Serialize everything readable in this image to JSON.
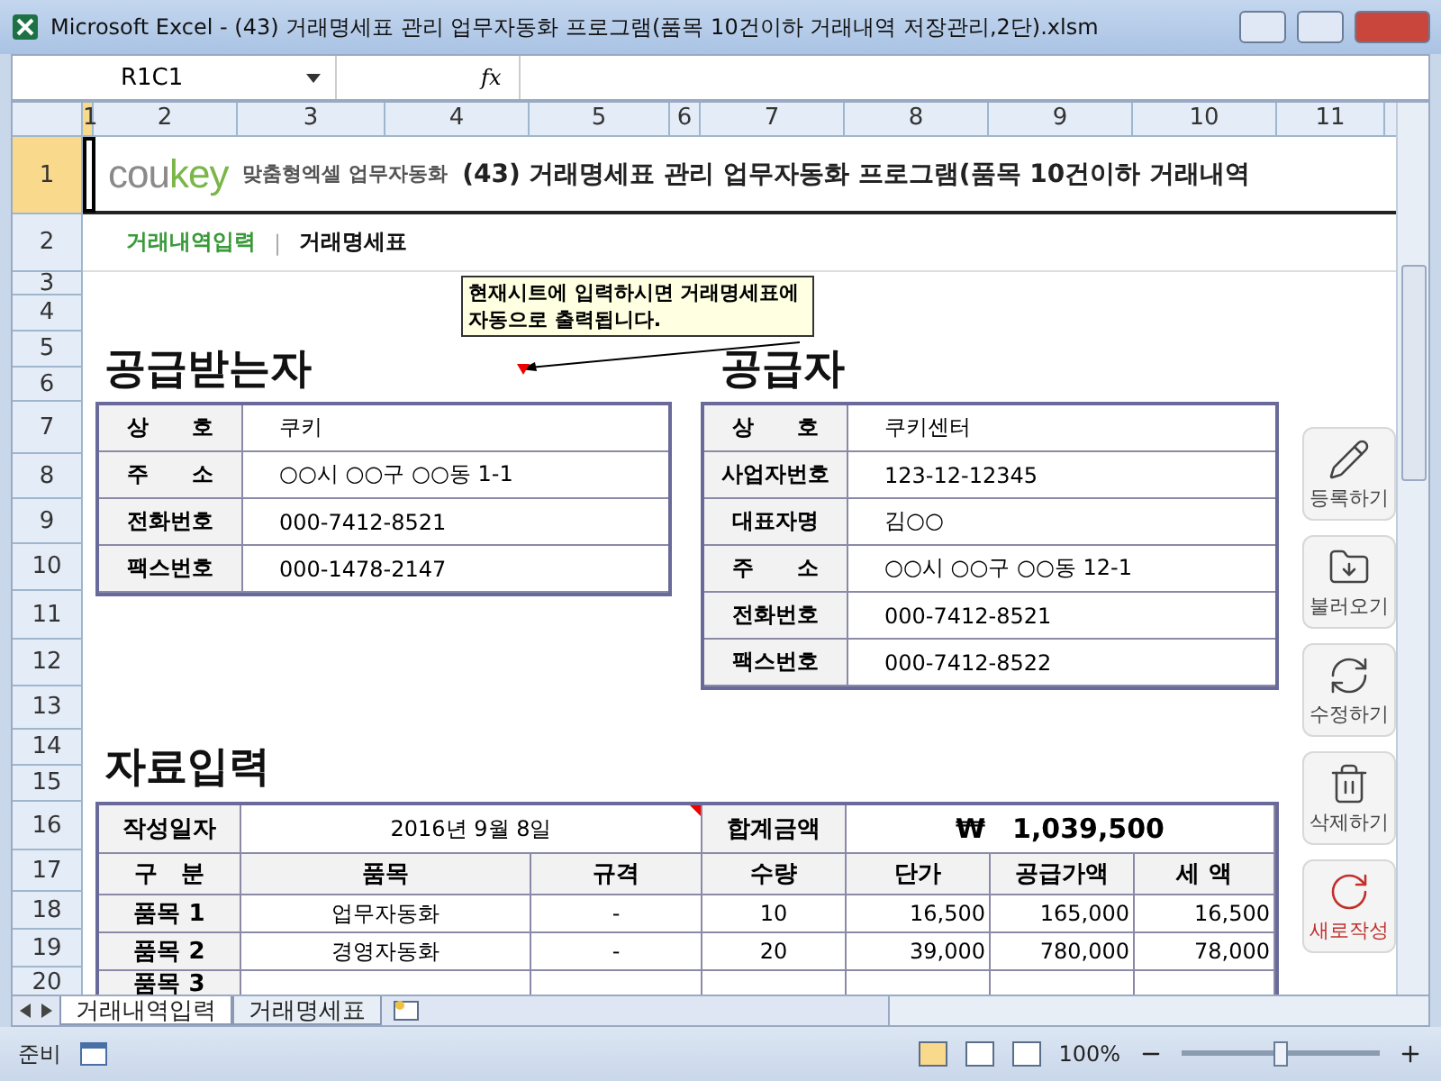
{
  "window": {
    "title": "Microsoft Excel - (43) 거래명세표 관리 업무자동화 프로그램(품목 10건이하 거래내역 저장관리,2단).xlsm"
  },
  "formula_bar": {
    "name_box": "R1C1",
    "fx": "fx"
  },
  "columns": [
    {
      "label": "1",
      "selected": true
    },
    {
      "label": "2",
      "selected": false
    },
    {
      "label": "3",
      "selected": false
    },
    {
      "label": "4",
      "selected": false
    },
    {
      "label": "5",
      "selected": false
    },
    {
      "label": "6",
      "selected": false
    },
    {
      "label": "7",
      "selected": false
    },
    {
      "label": "8",
      "selected": false
    },
    {
      "label": "9",
      "selected": false
    },
    {
      "label": "10",
      "selected": false
    },
    {
      "label": "11",
      "selected": false
    }
  ],
  "rows": [
    {
      "label": "1",
      "selected": true
    },
    {
      "label": "2",
      "selected": false
    },
    {
      "label": "3",
      "selected": false
    },
    {
      "label": "4",
      "selected": false
    },
    {
      "label": "5",
      "selected": false
    },
    {
      "label": "6",
      "selected": false
    },
    {
      "label": "7",
      "selected": false
    },
    {
      "label": "8",
      "selected": false
    },
    {
      "label": "9",
      "selected": false
    },
    {
      "label": "10",
      "selected": false
    },
    {
      "label": "11",
      "selected": false
    },
    {
      "label": "12",
      "selected": false
    },
    {
      "label": "13",
      "selected": false
    },
    {
      "label": "14",
      "selected": false
    },
    {
      "label": "15",
      "selected": false
    },
    {
      "label": "16",
      "selected": false
    },
    {
      "label": "17",
      "selected": false
    },
    {
      "label": "18",
      "selected": false
    },
    {
      "label": "19",
      "selected": false
    },
    {
      "label": "20",
      "selected": false
    }
  ],
  "logo": {
    "part1": "cou",
    "part2": "key",
    "tagline": "맞춤형엑셀 업무자동화"
  },
  "title": "(43) 거래명세표 관리 업무자동화 프로그램(품목 10건이하 거래내역",
  "nav": {
    "separator": "|",
    "items": [
      {
        "label": "거래내역입력",
        "selected": false
      },
      {
        "label": "거래명세표",
        "selected": true
      }
    ]
  },
  "comment": "현재시트에 입력하시면 거래명세표에 자동으로 출력됩니다.",
  "recipient": {
    "heading": "공급받는자",
    "fields": [
      {
        "label": "상　　호",
        "value": "쿠키"
      },
      {
        "label": "주　　소",
        "value": "○○시 ○○구 ○○동 1-1"
      },
      {
        "label": "전화번호",
        "value": "000-7412-8521"
      },
      {
        "label": "팩스번호",
        "value": "000-1478-2147"
      }
    ]
  },
  "supplier": {
    "heading": "공급자",
    "fields": [
      {
        "label": "상　　호",
        "value": "쿠키센터"
      },
      {
        "label": "사업자번호",
        "value": "123-12-12345"
      },
      {
        "label": "대표자명",
        "value": "김○○"
      },
      {
        "label": "주　　소",
        "value": "○○시 ○○구 ○○동 12-1"
      },
      {
        "label": "전화번호",
        "value": "000-7412-8521"
      },
      {
        "label": "팩스번호",
        "value": "000-7412-8522"
      }
    ]
  },
  "data_entry": {
    "heading": "자료입력",
    "date_label": "작성일자",
    "date": "2016년 9월 8일",
    "total_label": "합계금액",
    "total": "₩　1,039,500",
    "columns": [
      "구　분",
      "품목",
      "규격",
      "수량",
      "단가",
      "공급가액",
      "세 액"
    ],
    "items": [
      [
        "품목 1",
        "업무자동화",
        "-",
        "10",
        "16,500",
        "165,000",
        "16,500"
      ],
      [
        "품목 2",
        "경영자동화",
        "-",
        "20",
        "39,000",
        "780,000",
        "78,000"
      ],
      [
        "품목 3"
      ]
    ]
  },
  "side_buttons": [
    {
      "kind": "pencil",
      "label": "등록하기"
    },
    {
      "kind": "folder",
      "label": "불러오기"
    },
    {
      "kind": "refresh",
      "label": "수정하기"
    },
    {
      "kind": "trash",
      "label": "삭제하기"
    },
    {
      "kind": "new",
      "label": "새로작성"
    }
  ],
  "sheet_tabs": [
    {
      "label": "거래내역입력",
      "selected": true
    },
    {
      "label": "거래명세표",
      "selected": false
    }
  ],
  "status_bar": {
    "status": "준비",
    "zoom": "100%",
    "level": 0.5
  }
}
